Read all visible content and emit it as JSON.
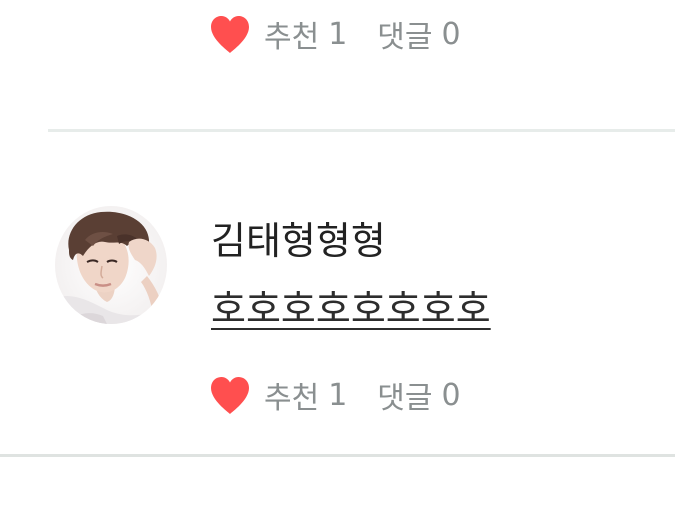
{
  "top_item": {
    "stats": {
      "like_label": "추천",
      "like_count": "1",
      "comment_label": "댓글",
      "comment_count": "0"
    }
  },
  "comment": {
    "author": "김태형형형",
    "text": "호호호호호호호호",
    "stats": {
      "like_label": "추천",
      "like_count": "1",
      "comment_label": "댓글",
      "comment_count": "0"
    }
  },
  "colors": {
    "heart": "#ff4f4f",
    "stats_text": "#8a8f90",
    "divider": "#e7ecea"
  },
  "icons": {
    "like": "heart-icon",
    "avatar": "user-avatar"
  }
}
